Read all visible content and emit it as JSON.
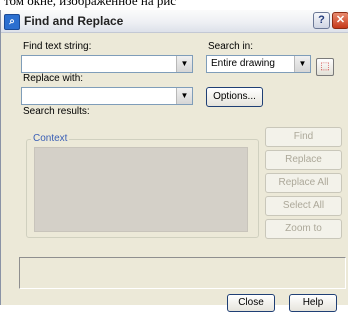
{
  "page_caption": "том окне, изображенное на рис",
  "window": {
    "title": "Find and Replace",
    "help_button": "?",
    "close_button": "✕"
  },
  "find": {
    "label": "Find text string:",
    "value": ""
  },
  "search_in": {
    "label": "Search in:",
    "value": "Entire drawing"
  },
  "replace": {
    "label": "Replace with:",
    "value": ""
  },
  "options_button": "Options...",
  "results": {
    "label": "Search results:",
    "context_label": "Context"
  },
  "actions": {
    "find": "Find",
    "replace": "Replace",
    "replace_all": "Replace All",
    "select_all": "Select All",
    "zoom_to": "Zoom to"
  },
  "footer": {
    "close": "Close",
    "help": "Help"
  },
  "icons": {
    "app": "find-replace-icon",
    "pick": "select-objects-icon",
    "dropdown": "chevron-down-icon"
  },
  "colors": {
    "dialog_bg": "#ece9d8",
    "button_border": "#1f3f75",
    "disabled_text": "#aca899",
    "group_title": "#3a5fb5"
  }
}
